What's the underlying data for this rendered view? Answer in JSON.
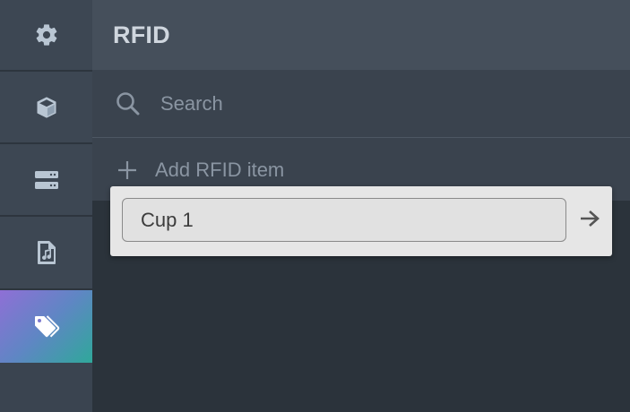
{
  "sidebar": {
    "items": [
      {
        "icon": "gear-icon",
        "active": false
      },
      {
        "icon": "cube-icon",
        "active": false
      },
      {
        "icon": "server-icon",
        "active": false
      },
      {
        "icon": "music-file-icon",
        "active": false
      },
      {
        "icon": "tags-icon",
        "active": true
      }
    ]
  },
  "header": {
    "title": "RFID"
  },
  "search": {
    "placeholder": "Search",
    "value": ""
  },
  "add_item": {
    "label": "Add RFID item"
  },
  "popup": {
    "input_value": "Cup 1",
    "submit_icon": "arrow-right-icon"
  },
  "colors": {
    "background": "#2b333b",
    "sidebar": "#3d4753",
    "header": "#454f5b",
    "active_gradient_start": "#8f6fd6",
    "active_gradient_end": "#2fa89a",
    "popup": "#e6e6e6"
  }
}
